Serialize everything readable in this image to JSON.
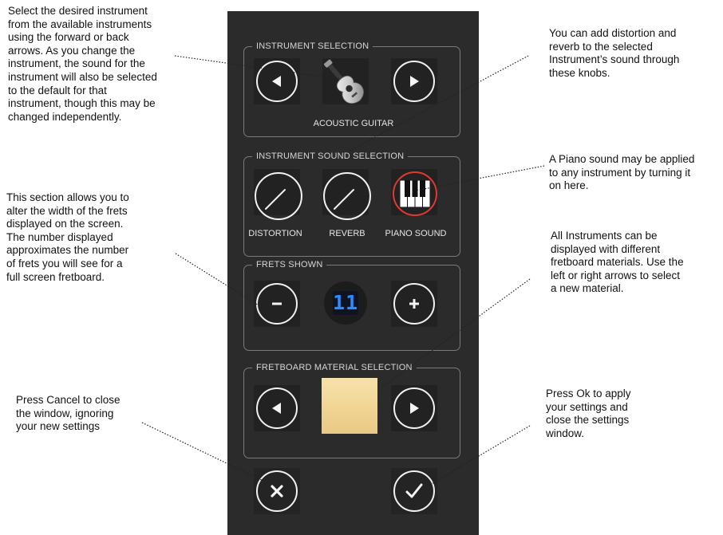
{
  "annotations": {
    "instrument_selection": "Select the desired instrument\nfrom the available instruments\nusing the forward or back\narrows. As you change the\ninstrument, the sound for the\ninstrument will also be selected\nto the default for that\ninstrument, though this may be\nchanged independently.",
    "effects": "You can add distortion and\nreverb to the selected\nInstrument’s sound through\nthese knobs.",
    "piano": "A Piano sound may be applied\nto any instrument by turning it\non here.",
    "frets": "This section allows you to\nalter the width of the frets\ndisplayed on the screen.\nThe number displayed\napproximates the number\nof frets you will see for a\nfull screen fretboard.",
    "material": "All Instruments can be\ndisplayed with different\nfretboard materials. Use the\nleft or right arrows to select\na new material.",
    "cancel": "Press Cancel to close\nthe window, ignoring\nyour new settings",
    "ok": "Press Ok to apply\nyour settings and\nclose the settings\nwindow."
  },
  "panel": {
    "instrument_selection": {
      "title": "INSTRUMENT SELECTION",
      "selected_instrument": "ACOUSTIC GUITAR",
      "instrument_icon": "acoustic-guitar-icon"
    },
    "sound_selection": {
      "title": "INSTRUMENT SOUND SELECTION",
      "distortion_label": "DISTORTION",
      "reverb_label": "REVERB",
      "piano_label": "PIANO SOUND",
      "piano_active_color": "#e03a2f"
    },
    "frets": {
      "title": "FRETS SHOWN",
      "value_display": "11",
      "display_color": "#2d8cff"
    },
    "material": {
      "title": "FRETBOARD MATERIAL SELECTION",
      "swatch_color": "#f3d79a"
    },
    "colors": {
      "panel_bg": "#2b2b2b",
      "control_stroke": "#f1f1f1"
    }
  }
}
